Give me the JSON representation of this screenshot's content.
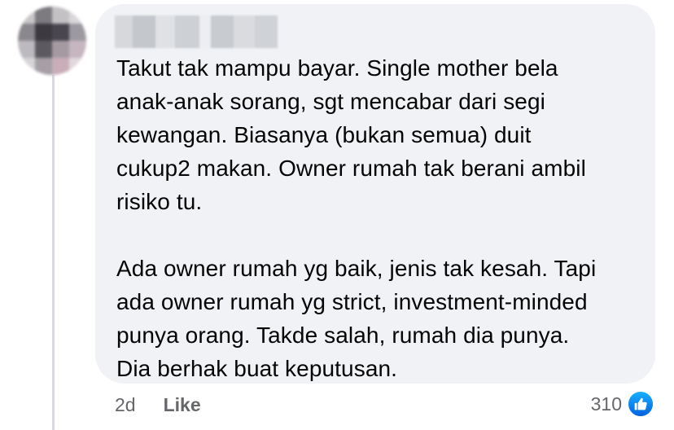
{
  "comment": {
    "text": "Takut tak mampu bayar. Single mother bela\nanak-anak sorang, sgt mencabar dari segi\nkewangan. Biasanya (bukan semua) duit\ncukup2 makan. Owner rumah tak berani ambil\nrisiko tu.\n\nAda owner rumah yg baik, jenis tak kesah. Tapi\nada owner rumah yg strict, investment-minded\npunya orang. Takde salah, rumah dia punya.\nDia berhak buat keputusan.",
    "timestamp": "2d",
    "like_label": "Like",
    "reaction_count": "310",
    "reaction_icon": "like-thumb-icon"
  },
  "colors": {
    "bubble": "#f0f2f5",
    "text": "#050505",
    "secondary": "#65676b",
    "like_blue": "#0866ff"
  }
}
